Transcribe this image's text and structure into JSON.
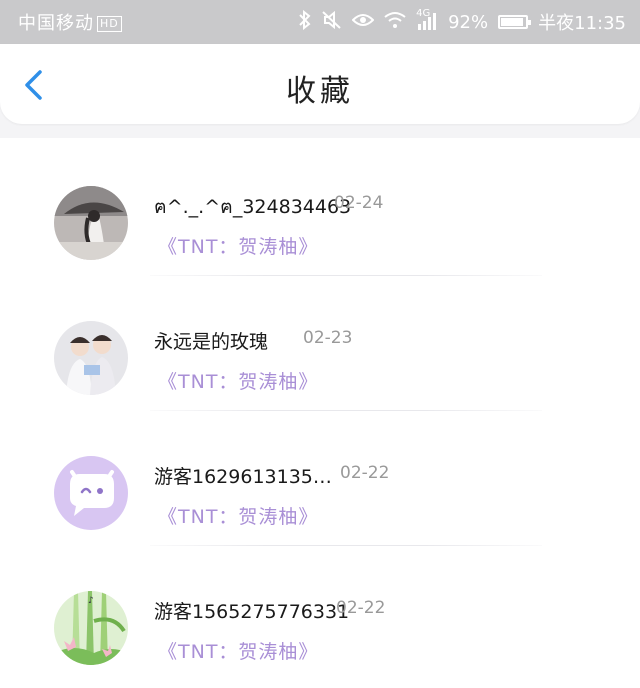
{
  "status_bar": {
    "carrier": "中国移动",
    "hd_badge": "HD",
    "network": "4G",
    "battery": "92%",
    "battery_level": 0.92,
    "time": "半夜11:35"
  },
  "header": {
    "title": "收藏",
    "back_icon": "chevron-left-icon"
  },
  "colors": {
    "accent_blue": "#2f8fe8",
    "tag_purple": "#a98fd6",
    "avatar_purple": "#d8c6f2"
  },
  "items": [
    {
      "name": "ฅ^._.^ฅ_324834463",
      "date": "02-24",
      "tag": "《TNT：贺涛柚》",
      "avatar": "user-photo-umbrella"
    },
    {
      "name": "永远是的玫瑰",
      "date": "02-23",
      "tag": "《TNT：贺涛柚》",
      "avatar": "user-photo-two-boys"
    },
    {
      "name": "游客1629613135…",
      "date": "02-22",
      "tag": "《TNT：贺涛柚》",
      "avatar": "default-chat-face-icon"
    },
    {
      "name": "游客1565275776331",
      "date": "02-22",
      "tag": "《TNT：贺涛柚》",
      "avatar": "user-photo-lotus"
    }
  ]
}
